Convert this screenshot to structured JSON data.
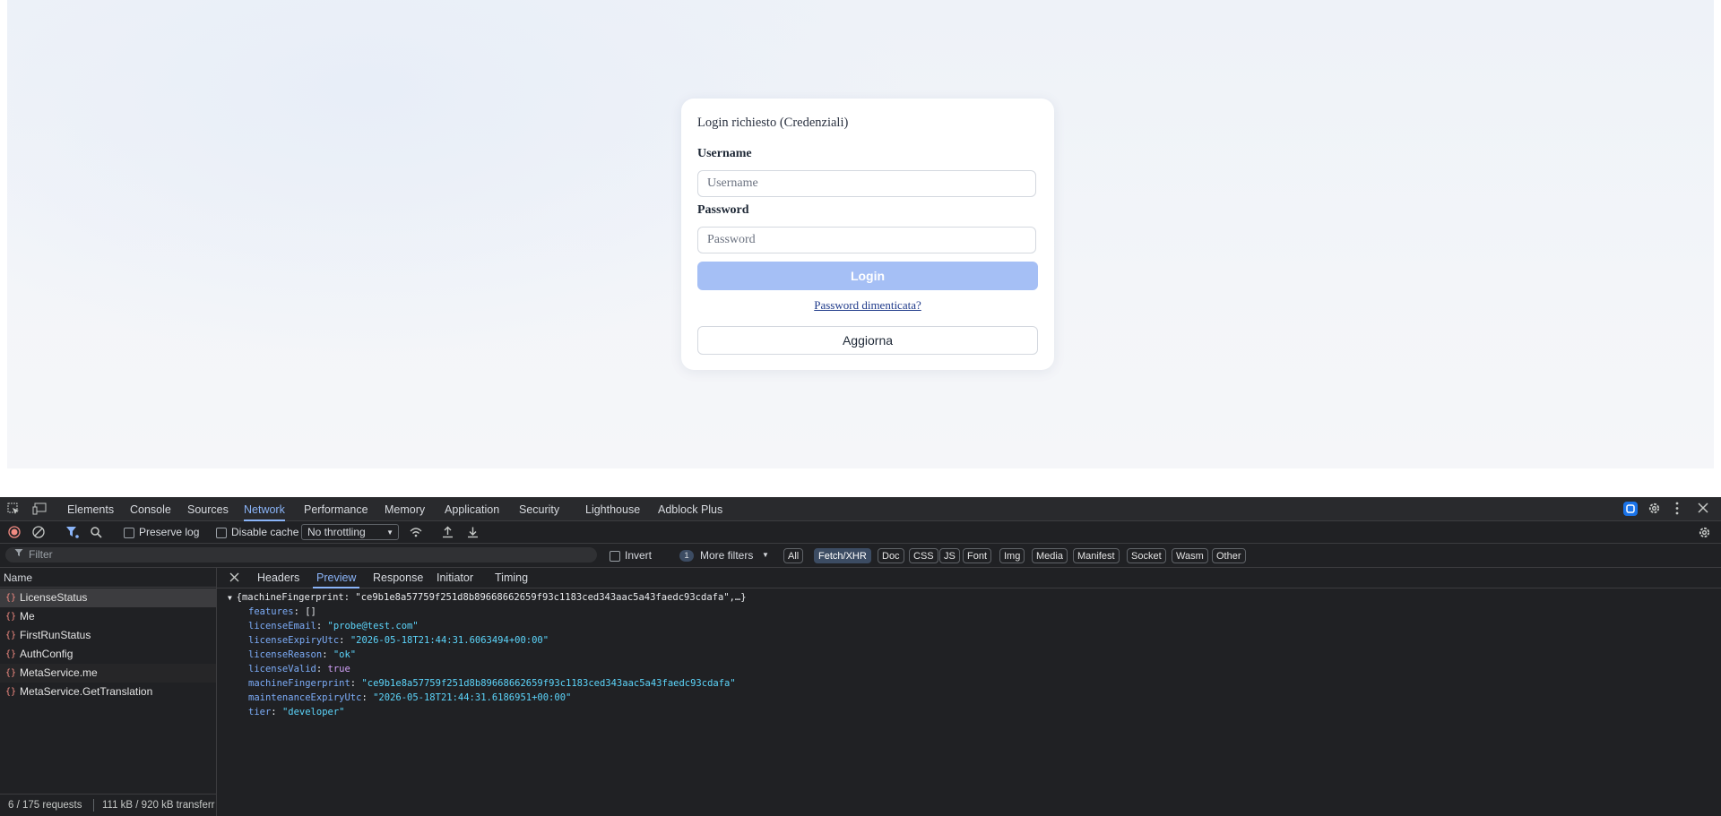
{
  "login": {
    "title": "Login richiesto (Credenziali)",
    "username_label": "Username",
    "username_placeholder": "Username",
    "password_label": "Password",
    "password_placeholder": "Password",
    "login_button": "Login",
    "forgot_link": "Password dimenticata?",
    "update_button": "Aggiorna",
    "login_button_color": "#a5bff5"
  },
  "devtools": {
    "tabs": [
      "Elements",
      "Console",
      "Sources",
      "Network",
      "Performance",
      "Memory",
      "Application",
      "Security",
      "Lighthouse",
      "Adblock Plus"
    ],
    "active_tab": "Network",
    "toolbar": {
      "preserve_log": "Preserve log",
      "disable_cache": "Disable cache",
      "throttling": "No throttling"
    },
    "filter": {
      "placeholder": "Filter",
      "invert": "Invert",
      "more_filters_count": "1",
      "more_filters": "More filters",
      "chips": [
        "All",
        "Fetch/XHR",
        "Doc",
        "CSS",
        "JS",
        "Font",
        "Img",
        "Media",
        "Manifest",
        "Socket",
        "Wasm",
        "Other"
      ],
      "active_chip": "Fetch/XHR"
    },
    "requests": {
      "header": "Name",
      "items": [
        "LicenseStatus",
        "Me",
        "FirstRunStatus",
        "AuthConfig",
        "MetaService.me",
        "MetaService.GetTranslation"
      ],
      "status": "6 / 175 requests",
      "transfer": "111 kB / 920 kB transferr"
    },
    "detail_tabs": [
      "Headers",
      "Preview",
      "Response",
      "Initiator",
      "Timing"
    ],
    "active_detail_tab": "Preview",
    "preview": {
      "summary": "{machineFingerprint: \"ce9b1e8a57759f251d8b89668662659f93c1183ced343aac5a43faedc93cdafa\",…}",
      "fields": [
        {
          "key": "features",
          "value": "[]",
          "type": "array"
        },
        {
          "key": "licenseEmail",
          "value": "\"probe@test.com\"",
          "type": "string"
        },
        {
          "key": "licenseExpiryUtc",
          "value": "\"2026-05-18T21:44:31.6063494+00:00\"",
          "type": "string"
        },
        {
          "key": "licenseReason",
          "value": "\"ok\"",
          "type": "string"
        },
        {
          "key": "licenseValid",
          "value": "true",
          "type": "bool"
        },
        {
          "key": "machineFingerprint",
          "value": "\"ce9b1e8a57759f251d8b89668662659f93c1183ced343aac5a43faedc93cdafa\"",
          "type": "string"
        },
        {
          "key": "maintenanceExpiryUtc",
          "value": "\"2026-05-18T21:44:31.6186951+00:00\"",
          "type": "string"
        },
        {
          "key": "tier",
          "value": "\"developer\"",
          "type": "string"
        }
      ]
    }
  }
}
